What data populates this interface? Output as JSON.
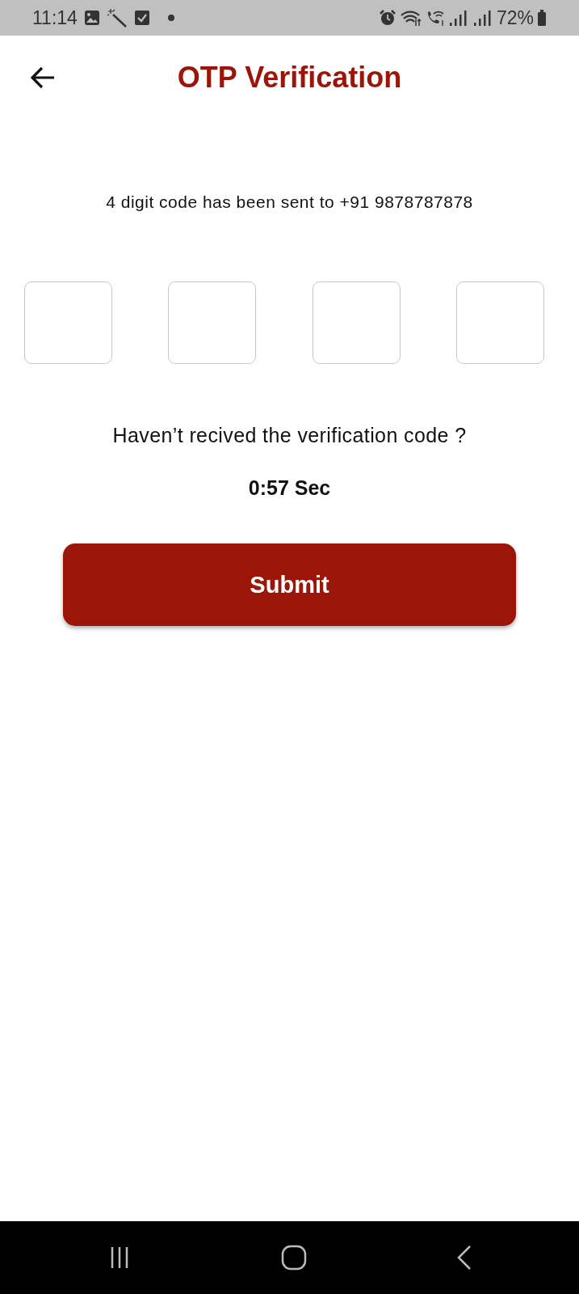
{
  "status_bar": {
    "time": "11:14",
    "battery": "72%"
  },
  "header": {
    "title": "OTP Verification"
  },
  "message": "4 digit code has been sent to +91 9878787878",
  "otp_fields": [
    {
      "focused": false
    },
    {
      "focused": false
    },
    {
      "focused": false
    },
    {
      "focused": false
    }
  ],
  "resend_prompt": "Haven’t recived the verification code ?",
  "timer": "0:57 Sec",
  "submit_button": {
    "label": "Submit"
  }
}
